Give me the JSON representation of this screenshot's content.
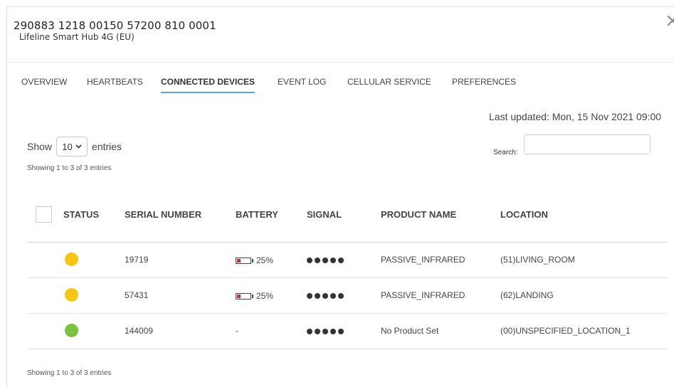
{
  "header": {
    "title": "290883 1218 00150 57200 810 0001",
    "subtitle": "Lifeline Smart Hub 4G (EU)",
    "close_icon": "close-icon"
  },
  "tabs": [
    {
      "label": "OVERVIEW",
      "active": false
    },
    {
      "label": "HEARTBEATS",
      "active": false
    },
    {
      "label": "CONNECTED DEVICES",
      "active": true
    },
    {
      "label": "EVENT LOG",
      "active": false
    },
    {
      "label": "CELLULAR SERVICE",
      "active": false
    },
    {
      "label": "PREFERENCES",
      "active": false
    }
  ],
  "last_updated": "Last updated: Mon, 15 Nov 2021 09:00",
  "length_menu": {
    "show": "Show",
    "value": "10",
    "entries": "entries"
  },
  "search": {
    "label": "Search:",
    "value": ""
  },
  "info_top": "Showing 1 to 3 of 3 entries",
  "info_bottom": "Showing 1 to 3 of 3 entries",
  "table": {
    "columns": [
      "STATUS",
      "SERIAL NUMBER",
      "BATTERY",
      "SIGNAL",
      "PRODUCT NAME",
      "LOCATION"
    ],
    "rows": [
      {
        "status_color": "#f5c518",
        "serial": "19719",
        "battery": "25%",
        "battery_level": 0.25,
        "signal_bars": 5,
        "product": "PASSIVE_INFRARED",
        "location": "(51)LIVING_ROOM"
      },
      {
        "status_color": "#f5c518",
        "serial": "57431",
        "battery": "25%",
        "battery_level": 0.25,
        "signal_bars": 5,
        "product": "PASSIVE_INFRARED",
        "location": "(62)LANDING"
      },
      {
        "status_color": "#7cc142",
        "serial": "144009",
        "battery": "-",
        "battery_level": null,
        "signal_bars": 5,
        "product": "No Product Set",
        "location": "(00)UNSPECIFIED_LOCATION_1"
      }
    ]
  }
}
